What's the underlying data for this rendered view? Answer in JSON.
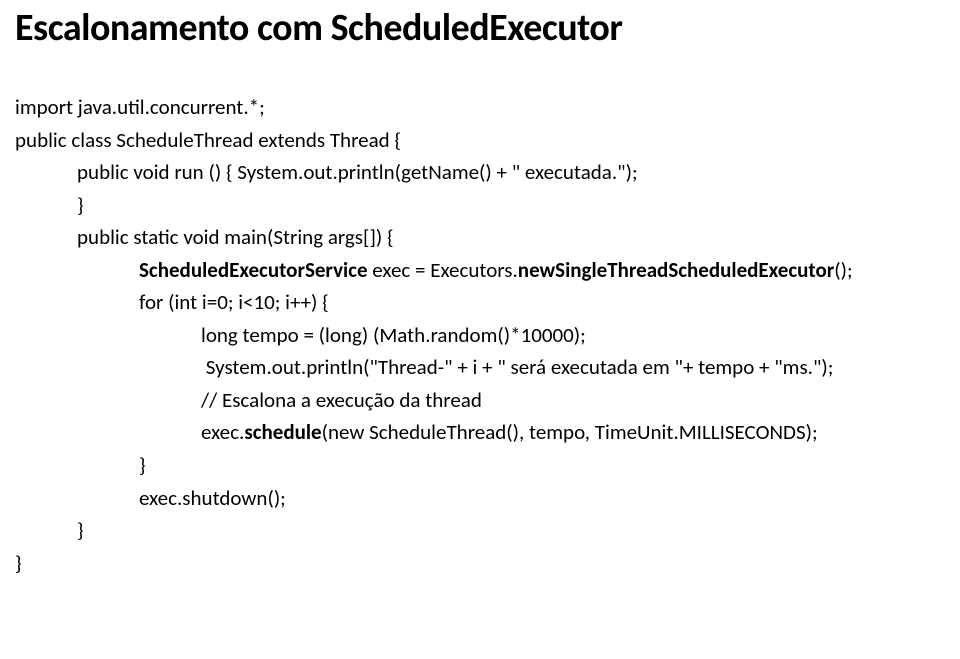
{
  "title": "Escalonamento com ScheduledExecutor",
  "code": {
    "l1": "import java.util.concurrent.*;",
    "l2": "public class ScheduleThread extends Thread {",
    "l3": "public void run () { System.out.println(getName() + \" executada.\");",
    "l4": "}",
    "l5": "public static void main(String args[]) {",
    "l6_a": "ScheduledExecutorService",
    "l6_b": " exec = Executors.",
    "l6_c": "newSingleThreadScheduledExecutor",
    "l6_d": "();",
    "l7": "for (int i=0; i<10; i++) {",
    "l8": "long tempo = (long) (Math.random()*10000);",
    "l9": " System.out.println(\"Thread-\" + i + \" será executada em \"+ tempo + \"ms.\");",
    "l10": "// Escalona a execução da thread",
    "l11_a": "exec.",
    "l11_b": "schedule",
    "l11_c": "(new ScheduleThread(), tempo, TimeUnit.MILLISECONDS);",
    "l12": "}",
    "l13": "exec.shutdown();",
    "l14": "}",
    "l15": "}"
  }
}
